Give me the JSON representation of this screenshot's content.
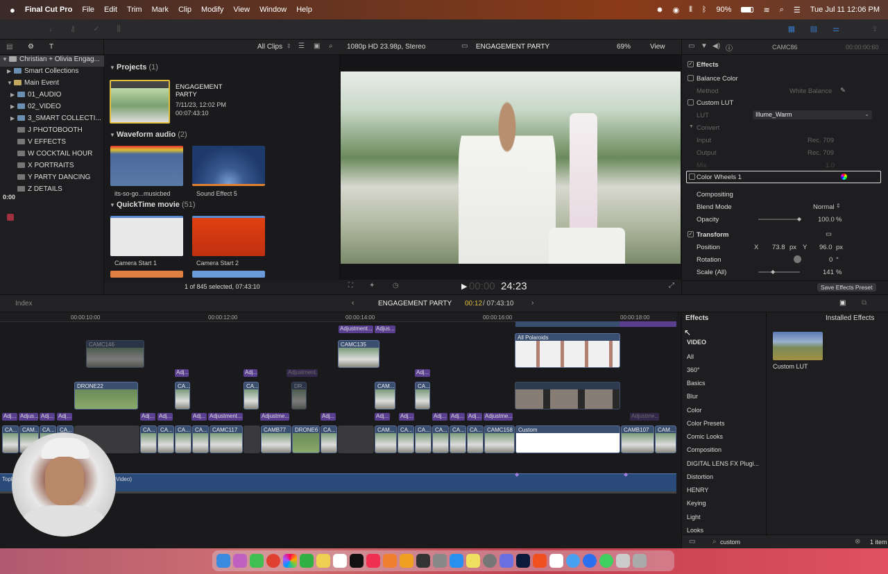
{
  "menubar": {
    "app": "Final Cut Pro",
    "items": [
      "File",
      "Edit",
      "Trim",
      "Mark",
      "Clip",
      "Modify",
      "View",
      "Window",
      "Help"
    ],
    "battery": "90%",
    "datetime": "Tue Jul 11  12:06 PM"
  },
  "libraries": {
    "root": "Christian + Olivia Engag...",
    "items": [
      {
        "label": "Smart Collections",
        "level": 1
      },
      {
        "label": "Main Event",
        "level": 1
      },
      {
        "label": "01_AUDIO",
        "level": 2
      },
      {
        "label": "02_VIDEO",
        "level": 2
      },
      {
        "label": "3_SMART COLLECTI...",
        "level": 2
      },
      {
        "label": "J PHOTOBOOTH",
        "level": 2
      },
      {
        "label": "V EFFECTS",
        "level": 2
      },
      {
        "label": "W COCKTAIL HOUR",
        "level": 2
      },
      {
        "label": "X PORTRAITS",
        "level": 2
      },
      {
        "label": "Y PARTY DANCING",
        "level": 2
      },
      {
        "label": "Z DETAILS",
        "level": 2
      }
    ],
    "timecode": "0:00"
  },
  "browser": {
    "filter": "All Clips",
    "sections": [
      {
        "title": "Projects",
        "count": "(1)"
      },
      {
        "title": "Waveform audio",
        "count": "(2)"
      },
      {
        "title": "QuickTime movie",
        "count": "(51)"
      }
    ],
    "project": {
      "name": "ENGAGEMENT PARTY",
      "date": "7/11/23, 12:02 PM",
      "duration": "00:07:43:10"
    },
    "audio_clips": [
      "its-so-go...musicbed",
      "Sound Effect 5"
    ],
    "movie_clips": [
      "Camera Start 1",
      "Camera Start 2"
    ],
    "status": "1 of 845 selected, 07:43:10"
  },
  "viewer": {
    "format": "1080p HD 23.98p, Stereo",
    "title": "ENGAGEMENT PARTY",
    "zoom": "69%",
    "view_label": "View",
    "timecode_dim": "00:00",
    "timecode": "24:23"
  },
  "inspector": {
    "clip": "CAMC86",
    "duration": "00:00:00:60",
    "effects_label": "Effects",
    "balance_color": "Balance Color",
    "method_label": "Method",
    "method_value": "White Balance",
    "custom_lut": "Custom LUT",
    "lut_label": "LUT",
    "lut_value": "Illume_Warm",
    "convert_label": "Convert",
    "input_label": "Input",
    "input_value": "Rec. 709",
    "output_label": "Output",
    "output_value": "Rec. 709",
    "mix_label": "Mix",
    "mix_value": "1.0",
    "color_wheels": "Color Wheels 1",
    "compositing": "Compositing",
    "blend_label": "Blend Mode",
    "blend_value": "Normal",
    "opacity_label": "Opacity",
    "opacity_value": "100.0",
    "opacity_unit": "%",
    "transform": "Transform",
    "position_label": "Position",
    "x_label": "X",
    "x_value": "73.8",
    "y_label": "Y",
    "y_value": "96.0",
    "px": "px",
    "rotation_label": "Rotation",
    "rotation_value": "0",
    "deg": "°",
    "scale_label": "Scale (All)",
    "scale_value": "141",
    "save_preset": "Save Effects Preset"
  },
  "timeline": {
    "index": "Index",
    "project": "ENGAGEMENT PARTY",
    "position": "00:12",
    "total": "/ 07:43:10",
    "ruler": [
      "00:00:10:00",
      "00:00:12:00",
      "00:00:14:00",
      "00:00:16:00",
      "00:00:18:00"
    ],
    "clip_names": {
      "camc146": "CAMC146",
      "drone22": "DRONE22",
      "camc135": "CAMC135",
      "polaroids": "All Polaroids",
      "camc117": "CAMC117",
      "camb77": "CAMB77",
      "drone6": "DRONE6",
      "camc158": "CAMC158",
      "custom": "Custom",
      "camb107": "CAMB107",
      "ca": "CA...",
      "cam": "CAM...",
      "adj": "Adj...",
      "adjustment": "Adjustment...",
      "adjustme": "Adjustme...",
      "adjus": "Adjus...",
      "dr": "DR...",
      "audio": "Video)",
      "topl": "Topl"
    }
  },
  "effects_browser": {
    "title": "Effects",
    "installed": "Installed Effects",
    "categories": [
      "VIDEO",
      "All",
      "360°",
      "Basics",
      "Blur",
      "Color",
      "Color Presets",
      "Comic Looks",
      "Composition",
      "DIGITAL LENS FX Plugi...",
      "Distortion",
      "HENRY",
      "Keying",
      "Light",
      "Looks"
    ],
    "result": "Custom LUT",
    "search": "custom",
    "count": "1 item"
  },
  "colors": {
    "accent": "#3a78c8",
    "clip_blue": "#3a4f70",
    "adjustment_purple": "#5a3f90"
  }
}
